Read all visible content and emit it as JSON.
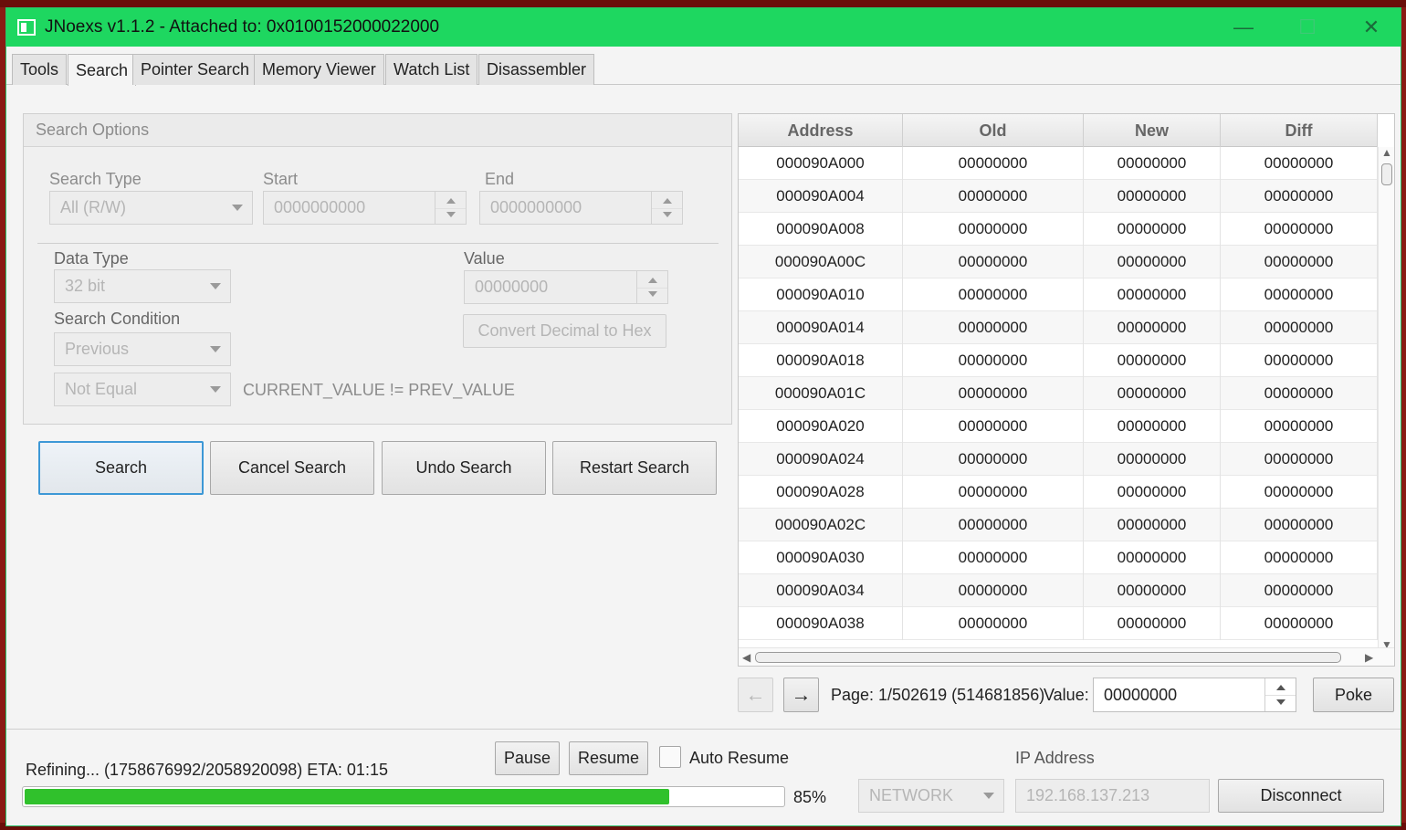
{
  "window": {
    "title": "JNoexs v1.1.2 - Attached to: 0x0100152000022000"
  },
  "tabs": [
    "Tools",
    "Search",
    "Pointer Search",
    "Memory Viewer",
    "Watch List",
    "Disassembler"
  ],
  "search_options": {
    "header": "Search Options",
    "search_type_label": "Search Type",
    "search_type_value": "All (R/W)",
    "start_label": "Start",
    "start_placeholder": "0000000000",
    "end_label": "End",
    "end_placeholder": "0000000000",
    "data_type_label": "Data Type",
    "data_type_value": "32 bit",
    "value_label": "Value",
    "value_placeholder": "00000000",
    "convert_button": "Convert Decimal to Hex",
    "search_condition_label": "Search Condition",
    "condition_value": "Previous",
    "comparison_value": "Not Equal",
    "expression": "CURRENT_VALUE != PREV_VALUE"
  },
  "actions": {
    "search": "Search",
    "cancel": "Cancel Search",
    "undo": "Undo Search",
    "restart": "Restart Search"
  },
  "results": {
    "columns": [
      "Address",
      "Old",
      "New",
      "Diff"
    ],
    "rows": [
      [
        "000090A000",
        "00000000",
        "00000000",
        "00000000"
      ],
      [
        "000090A004",
        "00000000",
        "00000000",
        "00000000"
      ],
      [
        "000090A008",
        "00000000",
        "00000000",
        "00000000"
      ],
      [
        "000090A00C",
        "00000000",
        "00000000",
        "00000000"
      ],
      [
        "000090A010",
        "00000000",
        "00000000",
        "00000000"
      ],
      [
        "000090A014",
        "00000000",
        "00000000",
        "00000000"
      ],
      [
        "000090A018",
        "00000000",
        "00000000",
        "00000000"
      ],
      [
        "000090A01C",
        "00000000",
        "00000000",
        "00000000"
      ],
      [
        "000090A020",
        "00000000",
        "00000000",
        "00000000"
      ],
      [
        "000090A024",
        "00000000",
        "00000000",
        "00000000"
      ],
      [
        "000090A028",
        "00000000",
        "00000000",
        "00000000"
      ],
      [
        "000090A02C",
        "00000000",
        "00000000",
        "00000000"
      ],
      [
        "000090A030",
        "00000000",
        "00000000",
        "00000000"
      ],
      [
        "000090A034",
        "00000000",
        "00000000",
        "00000000"
      ],
      [
        "000090A038",
        "00000000",
        "00000000",
        "00000000"
      ]
    ]
  },
  "pager": {
    "prev_icon": "←",
    "next_icon": "→",
    "page_text": "Page: 1/502619 (514681856)",
    "value_label": "Value:",
    "value": "00000000",
    "poke": "Poke"
  },
  "status": {
    "text": "Refining... (1758676992/2058920098) ETA: 01:15",
    "pause": "Pause",
    "resume": "Resume",
    "auto_resume": "Auto Resume",
    "progress_fraction": 0.85,
    "progress_label": "85%",
    "ip_label": "IP Address",
    "connection_mode": "NETWORK",
    "ip_value": "192.168.137.213",
    "disconnect": "Disconnect"
  },
  "colors": {
    "titlebar": "#1ed760",
    "progress": "#30c12c",
    "focus": "#3d98d6"
  }
}
